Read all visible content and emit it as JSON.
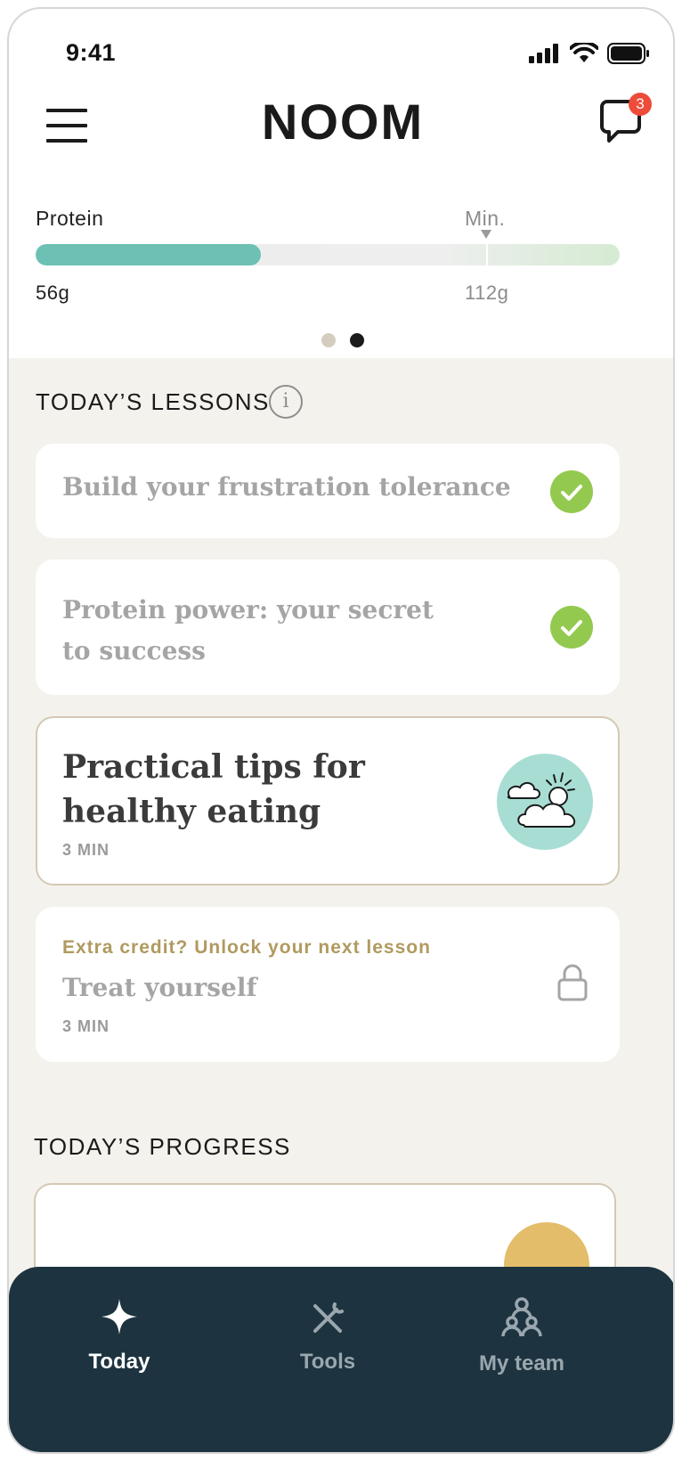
{
  "status_bar": {
    "time": "9:41"
  },
  "header": {
    "logo": "NOOM",
    "menu_icon": "hamburger-menu-icon",
    "chat_icon": "chat-bubble-icon",
    "unread_count": "3"
  },
  "protein_tracker": {
    "label": "Protein",
    "min_label": "Min.",
    "current_value": "56g",
    "min_value": "112g",
    "progress_fraction_of_track": 0.385,
    "min_marker_fraction_of_track": 0.772,
    "fill_color": "#6cc1b4"
  },
  "carousel": {
    "dots": [
      {
        "active": false,
        "color": "#d4cdbf"
      },
      {
        "active": true,
        "color": "#1b1b1b"
      }
    ]
  },
  "lessons": {
    "title": "TODAY’S LESSONS",
    "info_icon": "info-icon",
    "completed": [
      {
        "title": "Build your frustration tolerance",
        "status_icon": "checkmark-icon"
      },
      {
        "title": "Protein power: your secret to success",
        "status_icon": "checkmark-icon"
      }
    ],
    "current": {
      "title": "Practical tips for healthy eating",
      "duration": "3 MIN",
      "illustration": "sun-clouds-icon"
    },
    "locked": {
      "prompt": "Extra credit? Unlock your next lesson",
      "title": "Treat yourself",
      "duration": "3 MIN",
      "status_icon": "lock-icon"
    }
  },
  "progress": {
    "title": "TODAY’S PROGRESS"
  },
  "bottom_nav": {
    "items": [
      {
        "label": "Today",
        "icon": "sparkle-icon",
        "active": true
      },
      {
        "label": "Tools",
        "icon": "tools-icon",
        "active": false
      },
      {
        "label": "My team",
        "icon": "team-icon",
        "active": false
      }
    ]
  },
  "colors": {
    "accent": "#6cc1b4",
    "check": "#93c94f",
    "badge": "#ee4b3b",
    "nav_bg": "#1d3440",
    "feed_bg": "#f4f2ed",
    "gold": "#b09a5f"
  }
}
